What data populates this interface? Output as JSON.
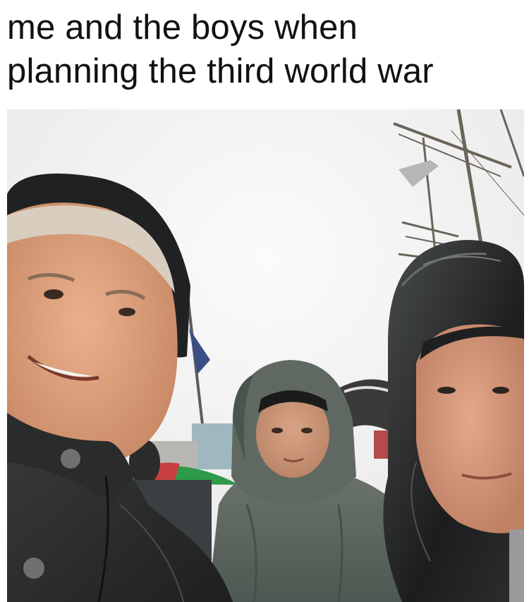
{
  "caption": {
    "line1": "me and the boys when",
    "line2": "planning the third world war"
  },
  "photo": {
    "description_icon": "selfie-photo",
    "colors": {
      "sky": "#f3f3f3",
      "raincoat_dark": "#2a2c2c",
      "poncho_green": "#5d6760",
      "skin": "#e0a584"
    }
  }
}
